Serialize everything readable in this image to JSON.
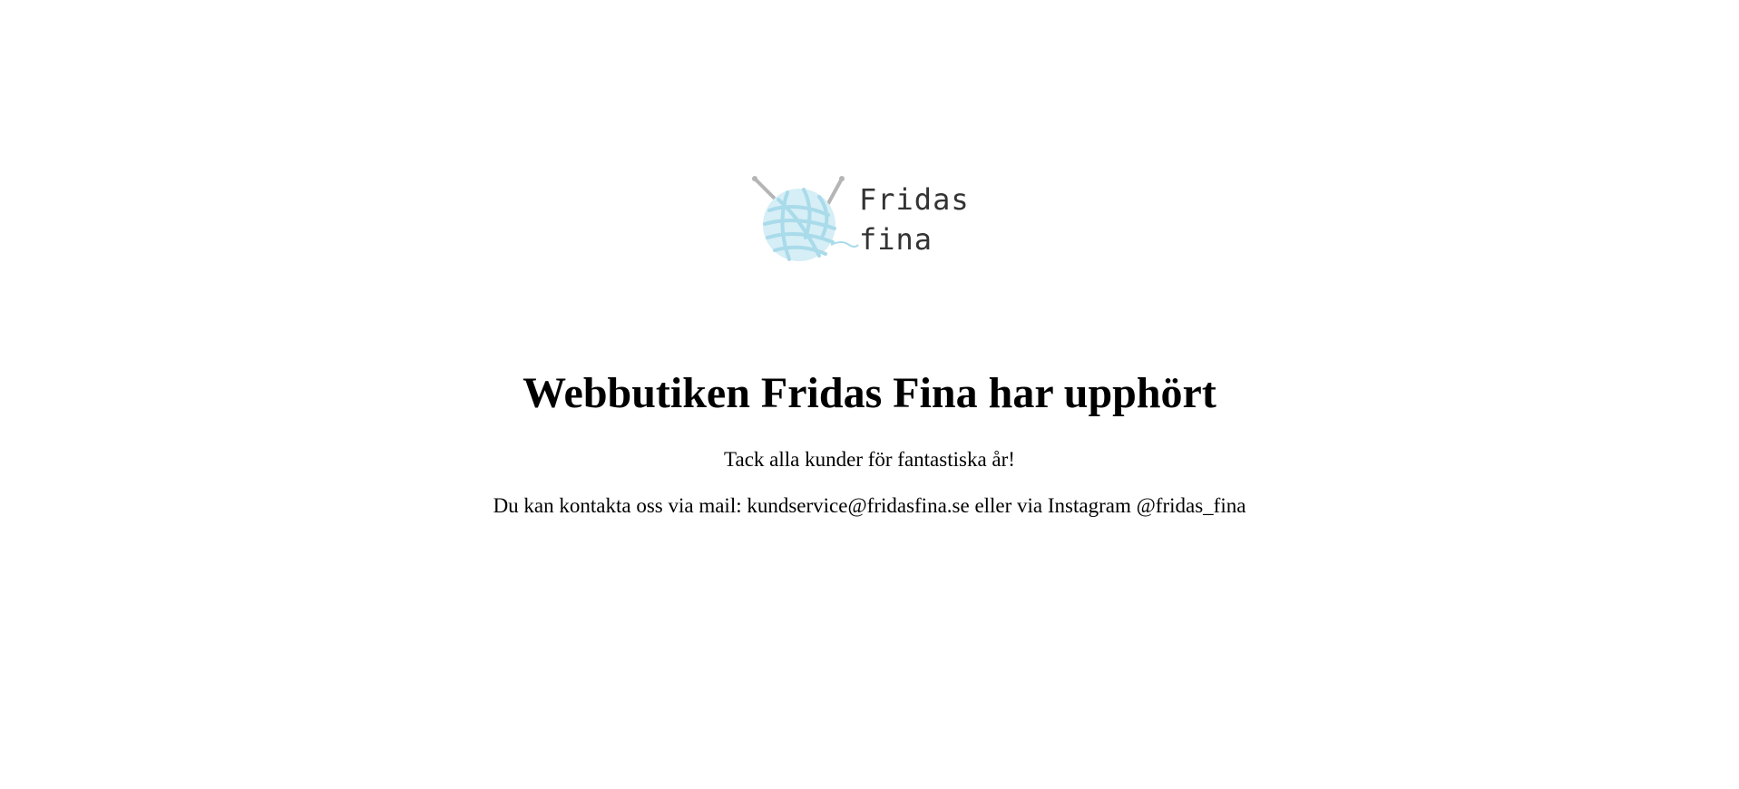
{
  "logo": {
    "line1": "Fridas",
    "line2": "fina",
    "icon": "yarn-ball-with-knitting-needles-icon",
    "yarn_color": "#a9dbea",
    "needle_color": "#b5b5b5"
  },
  "main": {
    "heading": "Webbutiken Fridas Fina har upphört",
    "thanks": "Tack alla kunder för fantastiska år!",
    "contact": "Du kan kontakta oss via mail: kundservice@fridasfina.se eller via Instagram @fridas_fina"
  }
}
